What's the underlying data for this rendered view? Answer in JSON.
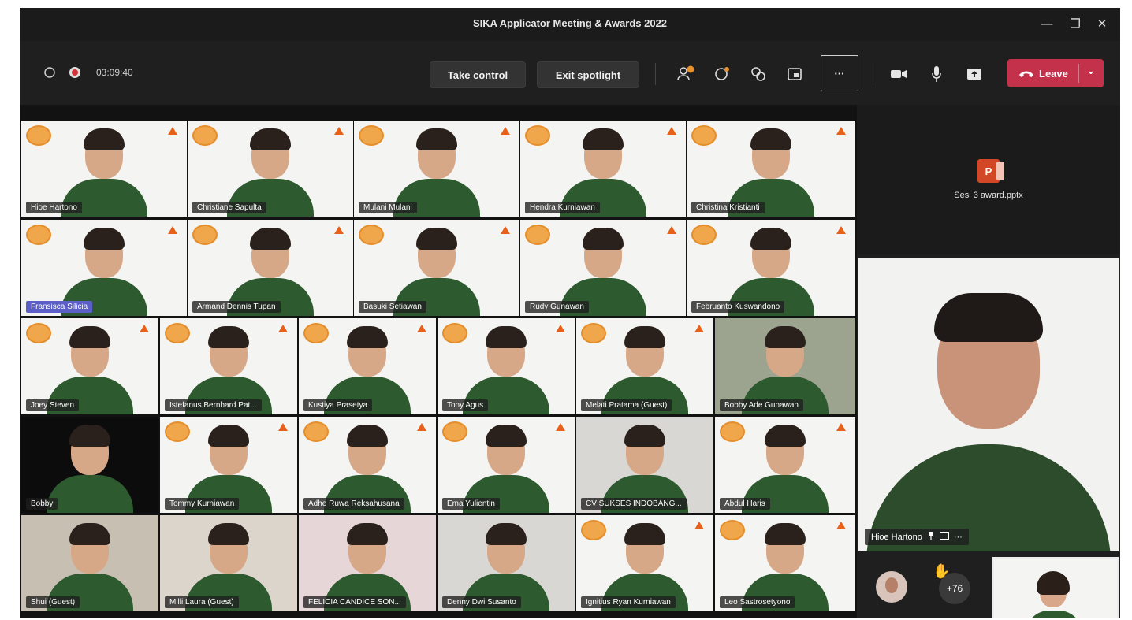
{
  "window": {
    "title": "SIKA Applicator Meeting & Awards 2022",
    "minimize_glyph": "—",
    "restore_glyph": "❐",
    "close_glyph": "✕"
  },
  "toolbar": {
    "timer": "03:09:40",
    "take_control": "Take control",
    "exit_spotlight": "Exit spotlight",
    "more_glyph": "···",
    "leave": "Leave",
    "leave_chevron": "⌄",
    "people_badge": "",
    "leave_color": "#c4314b"
  },
  "participants": [
    {
      "name": "Hioe Hartono",
      "bg": "white"
    },
    {
      "name": "Christiane Sapulta",
      "bg": "white"
    },
    {
      "name": "Mulani Mulani",
      "bg": "white"
    },
    {
      "name": "Hendra Kurniawan",
      "bg": "white"
    },
    {
      "name": "Christina Kristianti",
      "bg": "white"
    },
    {
      "name": "Fransisca Silicia",
      "bg": "white",
      "highlight": true
    },
    {
      "name": "Armand Dennis Tupan",
      "bg": "white"
    },
    {
      "name": "Basuki Setiawan",
      "bg": "white"
    },
    {
      "name": "Rudy Gunawan",
      "bg": "white"
    },
    {
      "name": "Februanto Kuswandono",
      "bg": "white"
    },
    {
      "name": "Joey Steven",
      "bg": "white"
    },
    {
      "name": "Istefanus Bernhard Pat...",
      "bg": "white"
    },
    {
      "name": "Kustiya Prasetya",
      "bg": "white"
    },
    {
      "name": "Tony Agus",
      "bg": "white"
    },
    {
      "name": "Melati Pratama (Guest)",
      "bg": "white"
    },
    {
      "name": "Bobby Ade Gunawan",
      "bg": "art"
    },
    {
      "name": "Bobby",
      "bg": "dark"
    },
    {
      "name": "Tommy Kurniawan",
      "bg": "white"
    },
    {
      "name": "Adhe Ruwa Reksahusana",
      "bg": "white"
    },
    {
      "name": "Ema Yulientin",
      "bg": "white"
    },
    {
      "name": "CV SUKSES INDOBANG...",
      "bg": "grey"
    },
    {
      "name": "Abdul Haris",
      "bg": "white"
    },
    {
      "name": "Shui (Guest)",
      "bg": "warm"
    },
    {
      "name": "Milli Laura (Guest)",
      "bg": "room"
    },
    {
      "name": "FELICIA CANDICE SON...",
      "bg": "pink"
    },
    {
      "name": "Denny Dwi Susanto",
      "bg": "grey"
    },
    {
      "name": "Ignitius Ryan Kurniawan",
      "bg": "white"
    },
    {
      "name": "Leo Sastrosetyono",
      "bg": "white"
    }
  ],
  "share": {
    "file_name": "Sesi 3 award.pptx",
    "app_letter": "P"
  },
  "speaker": {
    "name": "Hioe Hartono",
    "more_glyph": "···"
  },
  "tray": {
    "overflow_count": "+76",
    "hand_glyph": "✋"
  }
}
